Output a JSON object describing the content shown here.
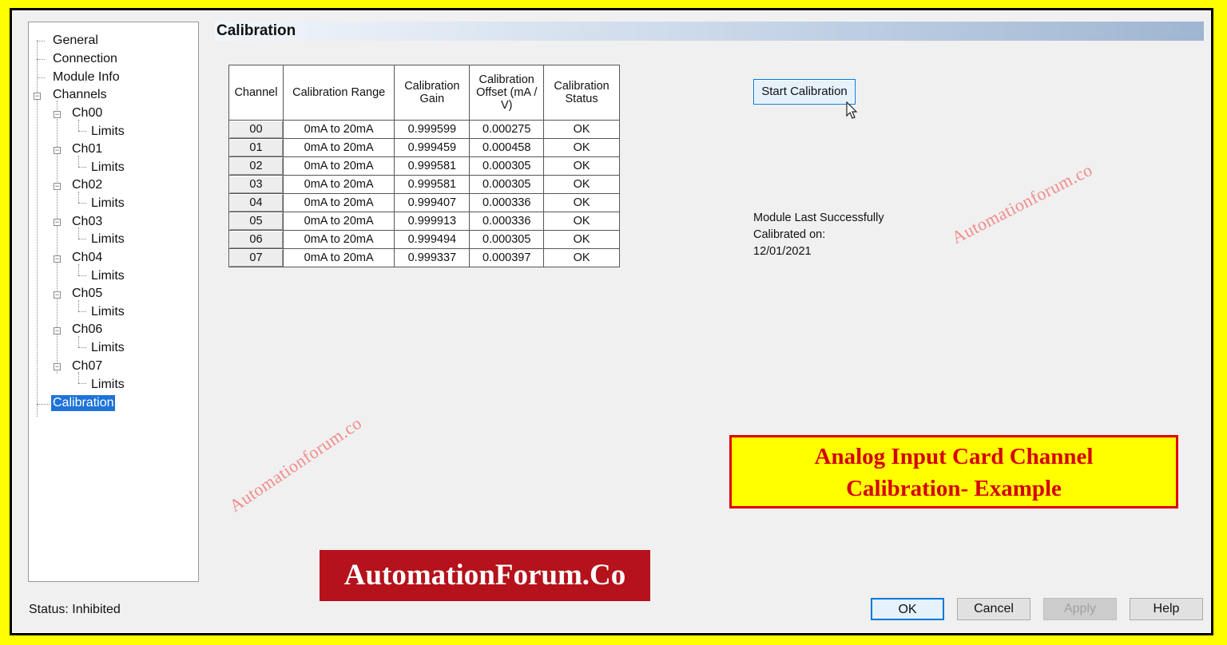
{
  "tree": {
    "items": [
      {
        "label": "General"
      },
      {
        "label": "Connection"
      },
      {
        "label": "Module Info"
      },
      {
        "label": "Channels"
      },
      {
        "label": "Ch00"
      },
      {
        "label": "Limits"
      },
      {
        "label": "Ch01"
      },
      {
        "label": "Limits"
      },
      {
        "label": "Ch02"
      },
      {
        "label": "Limits"
      },
      {
        "label": "Ch03"
      },
      {
        "label": "Limits"
      },
      {
        "label": "Ch04"
      },
      {
        "label": "Limits"
      },
      {
        "label": "Ch05"
      },
      {
        "label": "Limits"
      },
      {
        "label": "Ch06"
      },
      {
        "label": "Limits"
      },
      {
        "label": "Ch07"
      },
      {
        "label": "Limits"
      },
      {
        "label": "Calibration",
        "selected": true
      }
    ]
  },
  "header": {
    "title": "Calibration"
  },
  "table": {
    "headers": [
      "Channel",
      "Calibration Range",
      "Calibration Gain",
      "Calibration Offset (mA / V)",
      "Calibration Status"
    ],
    "rows": [
      [
        "00",
        "0mA to 20mA",
        "0.999599",
        "0.000275",
        "OK"
      ],
      [
        "01",
        "0mA to 20mA",
        "0.999459",
        "0.000458",
        "OK"
      ],
      [
        "02",
        "0mA to 20mA",
        "0.999581",
        "0.000305",
        "OK"
      ],
      [
        "03",
        "0mA to 20mA",
        "0.999581",
        "0.000305",
        "OK"
      ],
      [
        "04",
        "0mA to 20mA",
        "0.999407",
        "0.000336",
        "OK"
      ],
      [
        "05",
        "0mA to 20mA",
        "0.999913",
        "0.000336",
        "OK"
      ],
      [
        "06",
        "0mA to 20mA",
        "0.999494",
        "0.000305",
        "OK"
      ],
      [
        "07",
        "0mA to 20mA",
        "0.999337",
        "0.000397",
        "OK"
      ]
    ]
  },
  "start_button": {
    "label": "Start Calibration"
  },
  "last_calibrated": {
    "line1": "Module Last Successfully",
    "line2": "Calibrated on:",
    "date": "12/01/2021"
  },
  "watermark": {
    "text": "Automationforum.co"
  },
  "example_banner": {
    "line1": "Analog Input Card Channel",
    "line2": "Calibration- Example"
  },
  "brand": {
    "text": "AutomationForum.Co"
  },
  "status": {
    "text": "Status:  Inhibited"
  },
  "footer_buttons": {
    "ok": "OK",
    "cancel": "Cancel",
    "apply": "Apply",
    "help": "Help"
  },
  "colors": {
    "frame": "#ffff00",
    "selection": "#1e73d8",
    "banner_text": "#d40000",
    "brand_bg": "#b5121b"
  }
}
